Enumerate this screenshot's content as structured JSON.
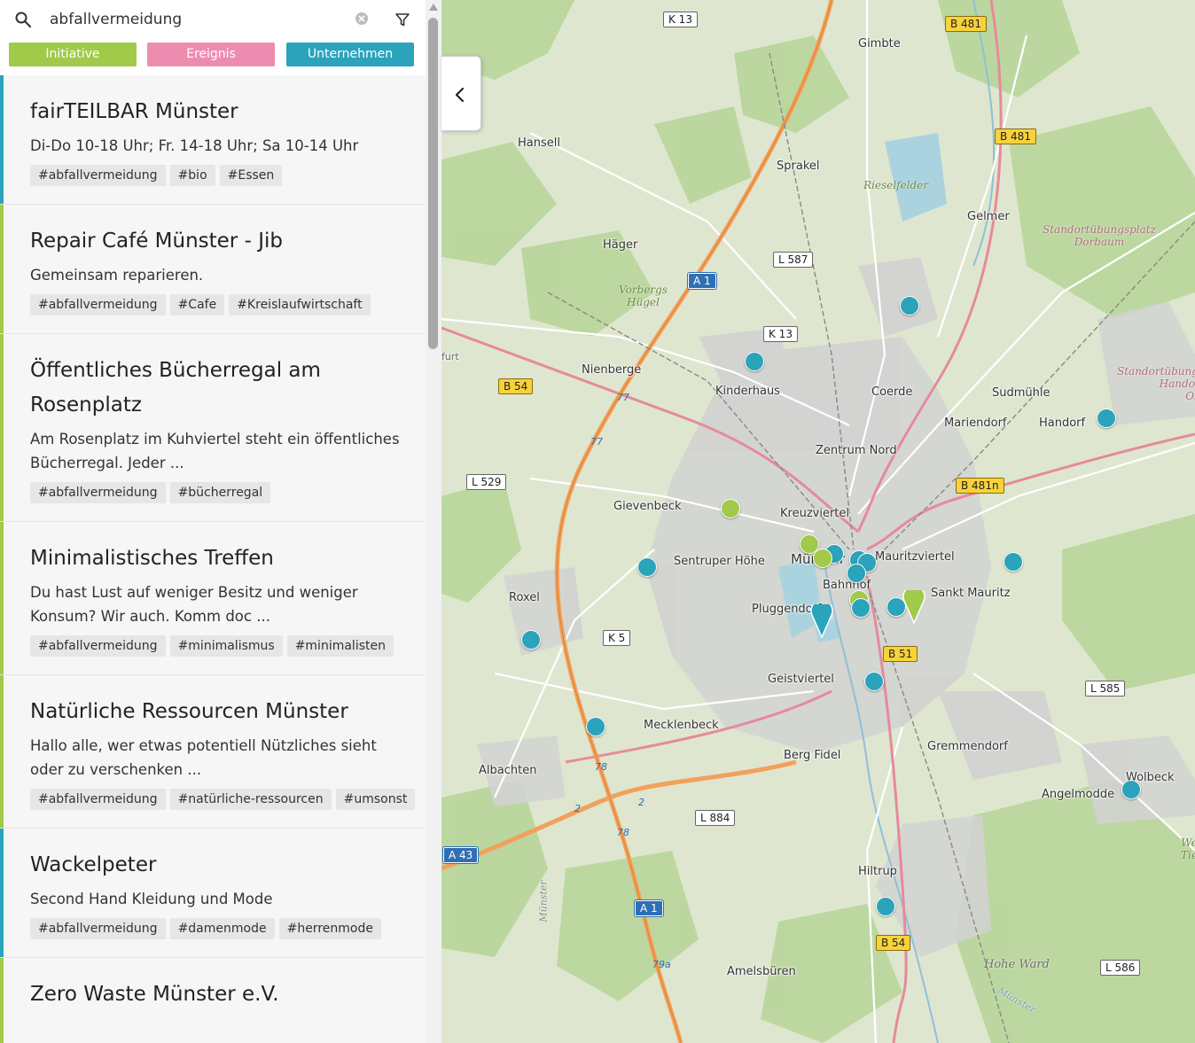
{
  "search": {
    "value": "abfallvermeidung",
    "placeholder": ""
  },
  "categories": {
    "initiative": "Initiative",
    "ereignis": "Ereignis",
    "unternehmen": "Unternehmen"
  },
  "entries": [
    {
      "title": "fairTEILBAR Münster",
      "description": "Di-Do 10-18 Uhr; Fr. 14-18 Uhr; Sa 10-14 Uhr",
      "tags": [
        "#abfallvermeidung",
        "#bio",
        "#Essen"
      ],
      "category_color": "#2aa3bb"
    },
    {
      "title": "Repair Café Münster - Jib",
      "description": "Gemeinsam reparieren.",
      "tags": [
        "#abfallvermeidung",
        "#Cafe",
        "#Kreislaufwirtschaft"
      ],
      "category_color": "#a1c94a"
    },
    {
      "title": "Öffentliches Bücherregal am Rosenplatz",
      "description": "Am Rosenplatz im Kuhviertel steht ein öffentliches Bücherregal. Jeder ...",
      "tags": [
        "#abfallvermeidung",
        "#bücherregal"
      ],
      "category_color": "#a1c94a"
    },
    {
      "title": "Minimalistisches Treffen",
      "description": "Du hast Lust auf weniger Besitz und weniger Konsum? Wir auch. Komm doc ...",
      "tags": [
        "#abfallvermeidung",
        "#minimalismus",
        "#minimalisten"
      ],
      "category_color": "#a1c94a"
    },
    {
      "title": "Natürliche Ressourcen Münster",
      "description": "Hallo alle, wer etwas potentiell Nützliches sieht oder zu verschenken ...",
      "tags": [
        "#abfallvermeidung",
        "#natürliche-ressourcen",
        "#umsonst"
      ],
      "category_color": "#a1c94a"
    },
    {
      "title": "Wackelpeter",
      "description": "Second Hand Kleidung und Mode",
      "tags": [
        "#abfallvermeidung",
        "#damenmode",
        "#herrenmode"
      ],
      "category_color": "#2aa3bb"
    },
    {
      "title": "Zero Waste Münster e.V.",
      "description": "",
      "tags": [],
      "category_color": "#a1c94a"
    }
  ],
  "map": {
    "places": {
      "gimbte": "Gimbte",
      "hansell": "Hansell",
      "sprakel": "Sprakel",
      "gelmer": "Gelmer",
      "hager": "Häger",
      "nienberge": "Nienberge",
      "kinderhaus": "Kinderhaus",
      "coerde": "Coerde",
      "sudmuehle": "Sudmühle",
      "mariendorf": "Mariendorf",
      "handorf": "Handorf",
      "zentrum_nord": "Zentrum Nord",
      "gievenbeck": "Gievenbeck",
      "kreuzviertel": "Kreuzviertel",
      "sentruper_hoehe": "Sentruper Höhe",
      "muenster": "Münster",
      "mauritzviertel": "Mauritzviertel",
      "bahnhof": "Bahnhof",
      "sankt_mauritz": "Sankt Mauritz",
      "roxel": "Roxel",
      "pluggendorf": "Pluggendorf",
      "geistviertel": "Geistviertel",
      "mecklenbeck": "Mecklenbeck",
      "berg_fidel": "Berg Fidel",
      "gremmendorf": "Gremmendorf",
      "albachten": "Albachten",
      "wolbeck": "Wolbeck",
      "angelmodde": "Angelmodde",
      "hiltrup": "Hiltrup",
      "amelsbueren": "Amelsbüren",
      "furt": "furt"
    },
    "areas": {
      "rieselfelder": "Rieselfelder",
      "standort_dorbaum": "Standortübungsplatz\nDorbaum",
      "vorbergs": "Vorbergs\nHügel",
      "standort_handorf": "Standortübungs\nHandorf\nOst",
      "hohe_ward": "Hohe Ward",
      "muenster_river": "Münster",
      "muenster_vert": "Münster",
      "we_tie": "We\nTie"
    },
    "shields": {
      "k13_top": "K 13",
      "b481_a": "B 481",
      "b481_b": "B 481",
      "l587": "L 587",
      "a1_top": "A 1",
      "k13_mid": "K 13",
      "b54_west": "B 54",
      "b481n": "B 481n",
      "l529": "L 529",
      "k5": "K 5",
      "b51": "B 51",
      "l585": "L 585",
      "l884": "L 884",
      "a43": "A 43",
      "a1_bottom": "A 1",
      "b54_south": "B 54",
      "l586": "L 586"
    },
    "road_numbers": {
      "r77a": "77",
      "r77b": "77",
      "r78a": "78",
      "r78b": "78",
      "r2a": "2",
      "r2b": "2",
      "r79a": "79a"
    }
  }
}
